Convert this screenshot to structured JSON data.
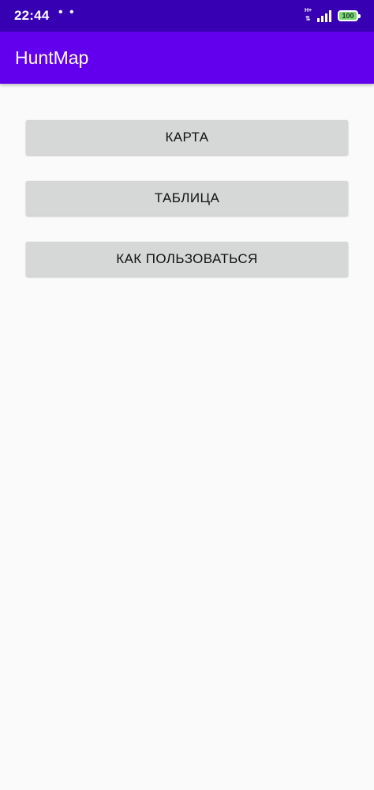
{
  "status_bar": {
    "time": "22:44",
    "notification_dots": "• •",
    "network_type_top": "H+",
    "network_type_bottom": "⇅",
    "signal_bars": 4,
    "battery_level": "100",
    "colors": {
      "background": "#3700b3",
      "battery_fill": "#7cd67c"
    }
  },
  "app_bar": {
    "title": "HuntMap",
    "color": "#6200ee"
  },
  "main": {
    "buttons": [
      {
        "label": "КАРТА"
      },
      {
        "label": "ТАБЛИЦА"
      },
      {
        "label": "КАК ПОЛЬЗОВАТЬСЯ"
      }
    ],
    "button_color": "#d6d7d7"
  }
}
